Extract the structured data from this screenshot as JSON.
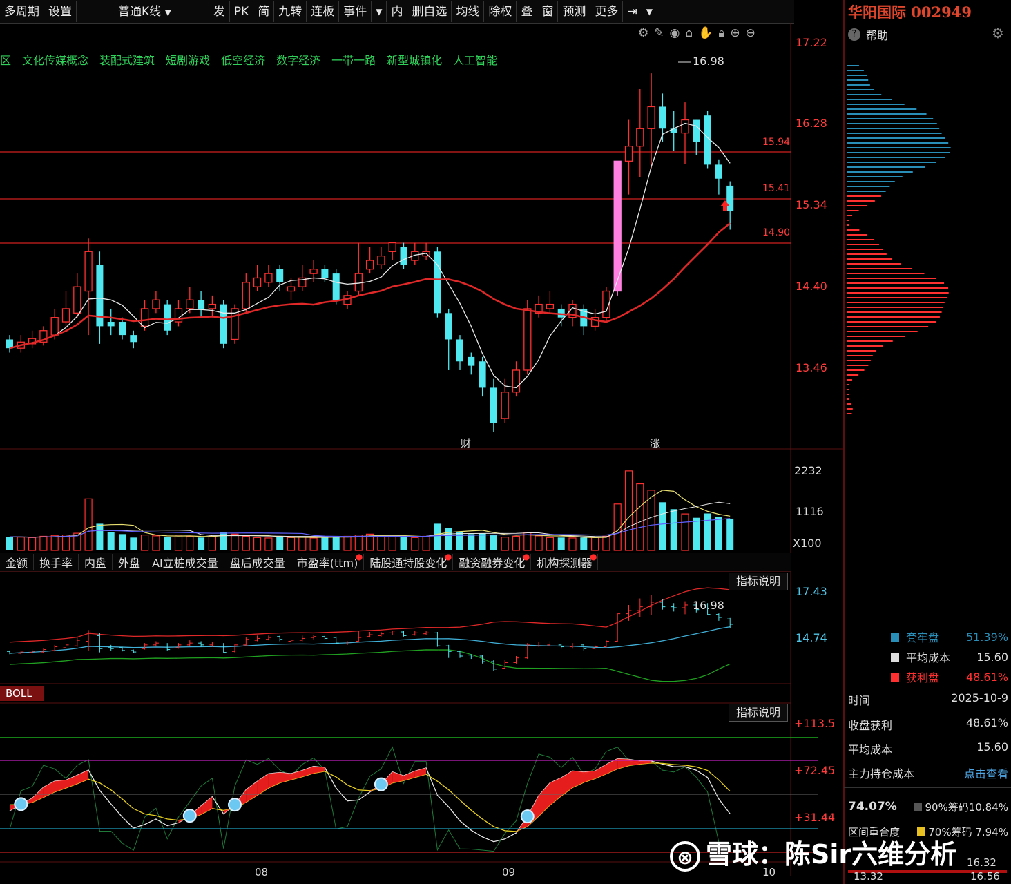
{
  "toolbar": {
    "items": [
      "多周期",
      "设置",
      "普通K线",
      "发",
      "PK",
      "简",
      "九转",
      "连板",
      "事件",
      "内",
      "删自选",
      "均线",
      "除权",
      "叠",
      "窗",
      "预测",
      "更多"
    ]
  },
  "stock": {
    "title": "华阳国际 002949"
  },
  "help_label": "帮助",
  "concepts": [
    "区",
    "文化传媒概念",
    "装配式建筑",
    "短剧游戏",
    "低空经济",
    "数字经济",
    "一带一路",
    "新型城镇化",
    "人工智能"
  ],
  "price_axis": [
    "17.22",
    "16.28",
    "15.34",
    "14.40",
    "13.46"
  ],
  "markers": {
    "high": "16.98",
    "level1": "15.94",
    "level2": "15.41",
    "level3": "14.90",
    "cai": "财",
    "zhang": "涨"
  },
  "volume_axis": [
    "2232",
    "1116",
    "X100"
  ],
  "tabs": [
    "金额",
    "换手率",
    "内盘",
    "外盘",
    "AI立桩成交量",
    "盘后成交量",
    "市盈率(ttm)",
    "陆股通持股变化",
    "融资融券变化",
    "机构探测器"
  ],
  "explain_label": "指标说明",
  "boll": {
    "label": "BOLL",
    "axis_top": "17.43",
    "axis_mid": "14.74",
    "high": "16.98"
  },
  "osc_axis": [
    "+113.5",
    "+72.45",
    "+31.44"
  ],
  "dates": [
    "08",
    "09",
    "10"
  ],
  "right_panel": {
    "legend": [
      {
        "name": "套牢盘",
        "value": "51.39%",
        "color": "#2a8fb8"
      },
      {
        "name": "平均成本",
        "value": "15.60",
        "color": "#dddddd"
      },
      {
        "name": "获利盘",
        "value": "48.61%",
        "color": "#ff3030"
      }
    ],
    "rows": [
      {
        "label": "时间",
        "value": "2025-10-9"
      },
      {
        "label": "收盘获利",
        "value": "48.61%"
      },
      {
        "label": "平均成本",
        "value": "15.60"
      },
      {
        "label": "主力持仓成本",
        "value": "点击查看"
      }
    ],
    "conc_pct": "74.07%",
    "conc90": "90%筹码10.84%",
    "overlap": "区间重合度",
    "conc70": "70%筹码 7.94%",
    "range_low": "13.32",
    "range_high": "16.56",
    "range_mid": "16.32"
  },
  "watermark": "雪球：陈Sir六维分析",
  "chart_data": {
    "type": "candlestick",
    "note": "Daily K-line for 华阳国际 002949, approx Jul–Oct 2025",
    "y_range": [
      12.9,
      17.5
    ],
    "candles": [
      [
        13.95,
        13.85,
        14.0,
        13.8
      ],
      [
        13.85,
        13.92,
        14.0,
        13.8
      ],
      [
        13.9,
        13.96,
        14.05,
        13.85
      ],
      [
        13.92,
        14.05,
        14.1,
        13.88
      ],
      [
        14.0,
        14.2,
        14.3,
        13.95
      ],
      [
        14.15,
        14.3,
        14.5,
        14.1
      ],
      [
        14.25,
        14.55,
        14.7,
        14.2
      ],
      [
        14.5,
        14.95,
        15.1,
        14.0
      ],
      [
        14.8,
        14.1,
        14.95,
        13.9
      ],
      [
        14.15,
        14.1,
        14.3,
        14.0
      ],
      [
        14.15,
        14.0,
        14.2,
        13.95
      ],
      [
        14.0,
        13.92,
        14.05,
        13.85
      ],
      [
        14.1,
        14.3,
        14.4,
        14.05
      ],
      [
        14.3,
        14.4,
        14.5,
        14.25
      ],
      [
        14.35,
        14.05,
        14.4,
        14.0
      ],
      [
        14.15,
        14.3,
        14.4,
        14.1
      ],
      [
        14.3,
        14.4,
        14.55,
        14.25
      ],
      [
        14.4,
        14.3,
        14.5,
        14.2
      ],
      [
        14.3,
        14.35,
        14.45,
        14.2
      ],
      [
        14.35,
        13.9,
        14.4,
        13.85
      ],
      [
        13.95,
        14.3,
        14.35,
        13.9
      ],
      [
        14.3,
        14.6,
        14.7,
        14.25
      ],
      [
        14.55,
        14.65,
        14.8,
        14.5
      ],
      [
        14.6,
        14.7,
        14.8,
        14.55
      ],
      [
        14.75,
        14.6,
        14.8,
        14.5
      ],
      [
        14.5,
        14.55,
        14.65,
        14.4
      ],
      [
        14.55,
        14.65,
        14.8,
        14.5
      ],
      [
        14.7,
        14.75,
        14.85,
        14.6
      ],
      [
        14.75,
        14.65,
        14.8,
        14.6
      ],
      [
        14.7,
        14.4,
        14.75,
        14.35
      ],
      [
        14.35,
        14.45,
        14.5,
        14.3
      ],
      [
        14.5,
        14.7,
        15.05,
        14.45
      ],
      [
        14.75,
        14.85,
        15.0,
        14.7
      ],
      [
        14.8,
        14.9,
        15.0,
        14.75
      ],
      [
        14.95,
        15.05,
        15.05,
        14.85
      ],
      [
        15.0,
        14.8,
        15.05,
        14.75
      ],
      [
        14.85,
        14.95,
        15.05,
        14.8
      ],
      [
        14.9,
        14.95,
        15.05,
        14.85
      ],
      [
        14.95,
        14.25,
        15.0,
        14.2
      ],
      [
        14.25,
        13.95,
        14.3,
        13.6
      ],
      [
        13.95,
        13.7,
        14.0,
        13.6
      ],
      [
        13.75,
        13.65,
        13.8,
        13.55
      ],
      [
        13.7,
        13.4,
        13.75,
        13.3
      ],
      [
        13.4,
        13.0,
        13.5,
        12.9
      ],
      [
        13.05,
        13.35,
        13.5,
        13.0
      ],
      [
        13.35,
        13.6,
        13.7,
        13.3
      ],
      [
        13.6,
        14.3,
        14.4,
        13.55
      ],
      [
        14.25,
        14.35,
        14.45,
        14.2
      ],
      [
        14.3,
        14.35,
        14.5,
        14.25
      ],
      [
        14.3,
        14.2,
        14.35,
        14.1
      ],
      [
        14.2,
        14.35,
        14.4,
        14.1
      ],
      [
        14.3,
        14.1,
        14.35,
        14.0
      ],
      [
        14.1,
        14.2,
        14.3,
        14.05
      ],
      [
        14.2,
        14.5,
        14.55,
        14.15
      ],
      [
        14.5,
        15.98,
        15.98,
        14.45
      ],
      [
        15.98,
        16.15,
        16.45,
        15.6
      ],
      [
        16.15,
        16.35,
        16.8,
        15.8
      ],
      [
        16.35,
        16.6,
        16.98,
        15.9
      ],
      [
        16.6,
        16.35,
        16.75,
        16.2
      ],
      [
        16.35,
        16.3,
        16.55,
        16.1
      ],
      [
        16.3,
        16.45,
        16.65,
        15.95
      ],
      [
        16.45,
        16.2,
        16.45,
        16.05
      ],
      [
        16.5,
        15.94,
        16.55,
        15.9
      ],
      [
        15.94,
        15.78,
        16.0,
        15.6
      ],
      [
        15.7,
        15.41,
        15.75,
        15.2
      ]
    ],
    "volumes": [
      320,
      310,
      300,
      330,
      350,
      360,
      400,
      1200,
      620,
      420,
      380,
      300,
      360,
      340,
      320,
      360,
      320,
      300,
      330,
      420,
      380,
      330,
      300,
      290,
      310,
      300,
      320,
      290,
      300,
      330,
      330,
      360,
      380,
      340,
      330,
      320,
      300,
      330,
      620,
      520,
      420,
      380,
      400,
      360,
      310,
      330,
      420,
      340,
      300,
      300,
      290,
      300,
      300,
      330,
      1080,
      1850,
      1550,
      1400,
      1120,
      960,
      850,
      760,
      860,
      780,
      740
    ],
    "ma_price_white": "MA5",
    "ma_price_red": "MA20"
  }
}
